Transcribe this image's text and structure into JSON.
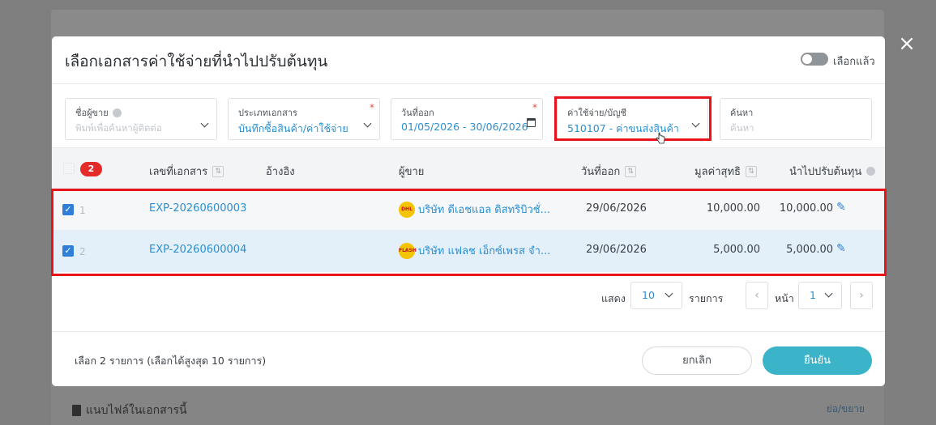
{
  "background": {
    "attach_label": "แนบไฟล์ในเอกสารนี้",
    "collapse_label": "ย่อ/ขยาย"
  },
  "close_icon": "×",
  "modal": {
    "title": "เลือกเอกสารค่าใช้จ่ายที่นำไปปรับต้นทุน",
    "toggle_label": "เลือกแล้ว",
    "filters": {
      "vendor": {
        "label": "ชื่อผู้ขาย",
        "placeholder": "พิมพ์เพื่อค้นหาผู้ติดต่อ"
      },
      "doc_type": {
        "label": "ประเภทเอกสาร",
        "value": "บันทึกซื้อสินค้า/ค่าใช้จ่าย"
      },
      "issue_date": {
        "label": "วันที่ออก",
        "value": "01/05/2026 - 30/06/2026"
      },
      "expense_account": {
        "label": "ค่าใช้จ่าย/บัญชี",
        "value": "510107 - ค่าขนส่งสินค้า"
      },
      "search": {
        "label": "ค้นหา",
        "placeholder": "ค้นหา"
      }
    },
    "table": {
      "selected_count": "2",
      "headers": {
        "doc_no": "เลขที่เอกสาร",
        "reference": "อ้างอิง",
        "vendor": "ผู้ขาย",
        "issue_date": "วันที่ออก",
        "net_value": "มูลค่าสุทธิ",
        "adjust_cost": "นำไปปรับต้นทุน"
      },
      "rows": [
        {
          "index": "1",
          "doc_no": "EXP-20260600003",
          "reference": "",
          "vendor": "บริษัท ดีเอชแอล ดิสทริบิวชั่...",
          "vendor_logo": "DHL",
          "issue_date": "29/06/2026",
          "net_value": "10,000.00",
          "adjust_cost": "10,000.00",
          "checked": true
        },
        {
          "index": "2",
          "doc_no": "EXP-20260600004",
          "reference": "",
          "vendor": "บริษัท แฟลช เอ็กซ์เพรส จำ...",
          "vendor_logo": "FLASH",
          "issue_date": "29/06/2026",
          "net_value": "5,000.00",
          "adjust_cost": "5,000.00",
          "checked": true
        }
      ]
    },
    "pagination": {
      "show_label": "แสดง",
      "per_page": "10",
      "items_label": "รายการ",
      "page_label": "หน้า",
      "page": "1"
    },
    "footer": {
      "selection_text": "เลือก 2 รายการ (เลือกได้สูงสุด 10 รายการ)",
      "cancel_label": "ยกเลิก",
      "confirm_label": "ยืนยัน"
    }
  },
  "colors": {
    "accent": "#2a8fd1",
    "confirm": "#3bb4c9",
    "highlight": "#e8141c",
    "badge": "#e52a2a"
  }
}
